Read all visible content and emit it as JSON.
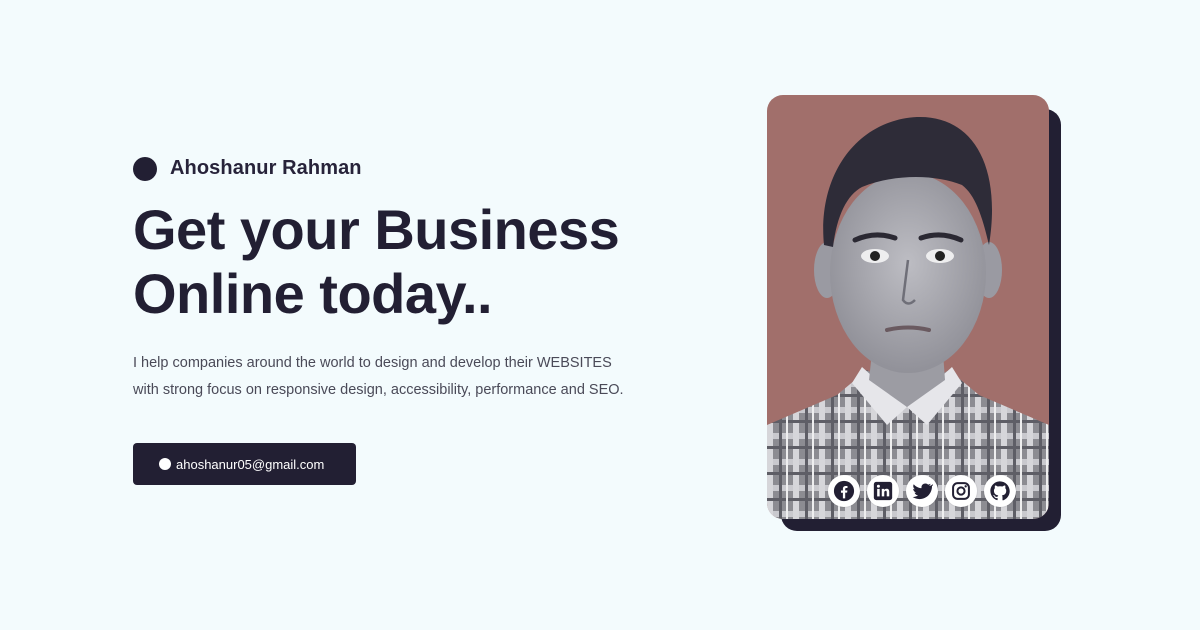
{
  "brand": {
    "name": "Ahoshanur Rahman"
  },
  "hero": {
    "headline_line1": "Get your Business",
    "headline_line2": "Online today..",
    "tagline_line1": "I help companies around the world to design and develop their WEBSITES",
    "tagline_line2": "with strong focus on responsive design, accessibility, performance and SEO."
  },
  "contact": {
    "email": "ahoshanur05@gmail.com"
  },
  "socials": [
    {
      "icon": "facebook-icon"
    },
    {
      "icon": "linkedin-icon"
    },
    {
      "icon": "twitter-icon"
    },
    {
      "icon": "instagram-icon"
    },
    {
      "icon": "github-icon"
    }
  ],
  "colors": {
    "background": "#f3fbfd",
    "dark": "#221f33",
    "portrait_background": "#a16f6b",
    "text_muted": "#4a4a58"
  }
}
